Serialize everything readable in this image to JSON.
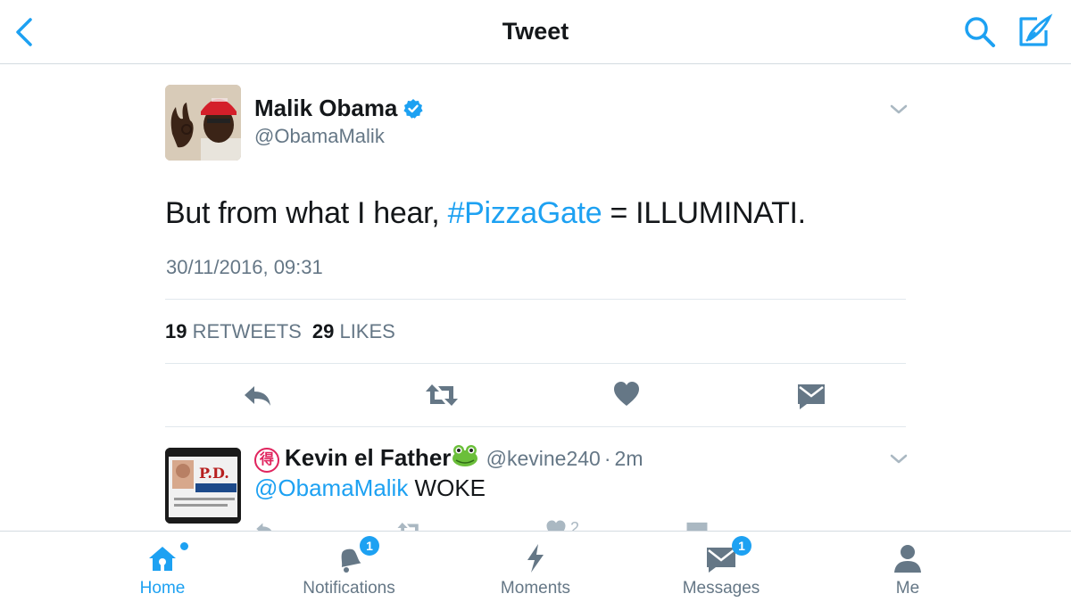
{
  "header": {
    "title": "Tweet"
  },
  "tweet": {
    "author_name": "Malik Obama",
    "author_handle": "@ObamaMalik",
    "text_before": "But from what I hear, ",
    "hashtag": "#PizzaGate",
    "text_after": " = ILLUMINATI.",
    "timestamp": "30/11/2016, 09:31",
    "retweets_count": "19",
    "retweets_label": "RETWEETS",
    "likes_count": "29",
    "likes_label": "LIKES"
  },
  "reply": {
    "badge_glyph": "得",
    "author_name": "Kevin el Father",
    "author_handle": "@kevine240",
    "separator": "·",
    "time": "2m",
    "mention": "@ObamaMalik",
    "text": " WOKE",
    "like_count": "2"
  },
  "tabbar": {
    "home": "Home",
    "notifications": "Notifications",
    "notifications_badge": "1",
    "moments": "Moments",
    "messages": "Messages",
    "messages_badge": "1",
    "me": "Me"
  },
  "colors": {
    "accent": "#1da1f2",
    "text": "#14171a",
    "secondary": "#657786",
    "divider": "#e1e8ed"
  },
  "icons": {
    "back": "chevron-left-icon",
    "search": "search-icon",
    "compose": "compose-icon",
    "reply": "reply-icon",
    "retweet": "retweet-icon",
    "like": "heart-icon",
    "dm": "envelope-icon",
    "home": "home-icon",
    "notifications": "bell-icon",
    "moments": "lightning-icon",
    "messages": "messages-icon",
    "me": "person-icon"
  }
}
